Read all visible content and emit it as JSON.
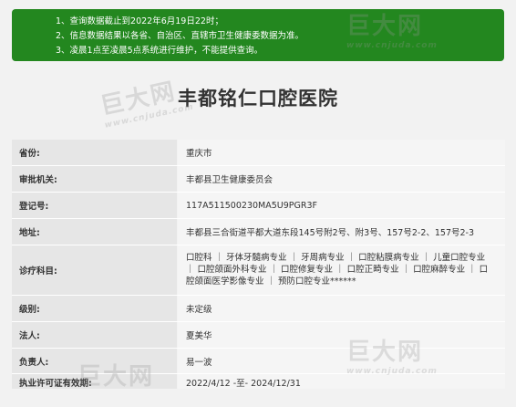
{
  "notice": {
    "lines": [
      "1、查询数据截止到2022年6月19日22时；",
      "2、信息数据结果以各省、自治区、直辖市卫生健康委数据为准。",
      "3、凌晨1点至凌晨5点系统进行维护，不能提供查询。"
    ]
  },
  "hospital_name": "丰都铭仁口腔医院",
  "rows": [
    {
      "label": "省份:",
      "value": "重庆市"
    },
    {
      "label": "审批机关:",
      "value": "丰都县卫生健康委员会"
    },
    {
      "label": "登记号:",
      "value": "117A511500230MA5U9PGR3F"
    },
    {
      "label": "地址:",
      "value": "丰都县三合街道平都大道东段145号附2号、附3号、157号2-2、157号2-3"
    },
    {
      "label": "诊疗科目:",
      "value": "口腔科 ｜ 牙体牙髓病专业 ｜ 牙周病专业 ｜ 口腔粘膜病专业 ｜ 儿童口腔专业 ｜ 口腔颌面外科专业 ｜ 口腔修复专业 ｜ 口腔正畸专业 ｜ 口腔麻醉专业 ｜ 口腔颌面医学影像专业 ｜ 预防口腔专业******"
    },
    {
      "label": "级别:",
      "value": "未定级"
    },
    {
      "label": "法人:",
      "value": "夏美华"
    },
    {
      "label": "负责人:",
      "value": "易一波"
    },
    {
      "label": "执业许可证有效期:",
      "value": "2022/4/12 -至- 2024/12/31"
    }
  ],
  "watermark": {
    "brand": "巨大网",
    "url": "www.cnjuda.com"
  }
}
